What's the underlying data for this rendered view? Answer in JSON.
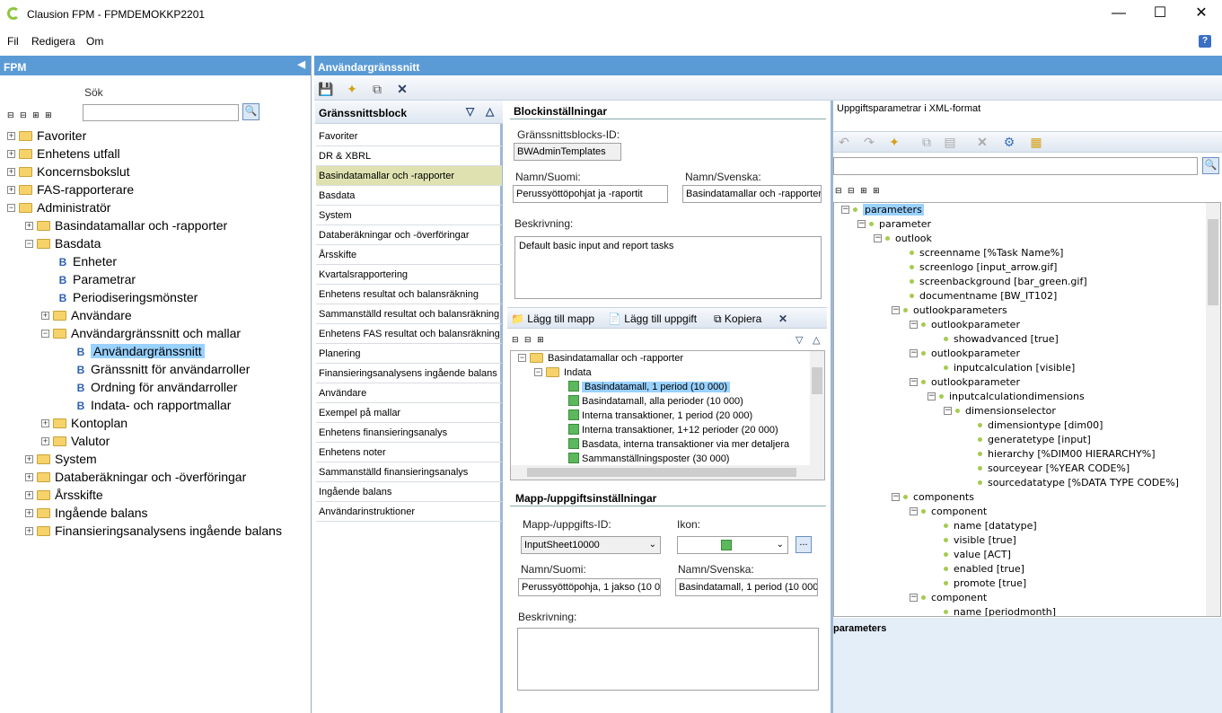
{
  "window": {
    "title": "Clausion FPM - FPMDEMOKKP2201"
  },
  "menu": [
    "Fil",
    "Redigera",
    "Om"
  ],
  "left": {
    "header": "FPM",
    "search_label": "Sök",
    "tree": [
      "Favoriter",
      "Enhetens utfall",
      "Koncernsbokslut",
      "FAS-rapporterare",
      "Administratör",
      "Basindatamallar och -rapporter",
      "Basdata",
      "Enheter",
      "Parametrar",
      "Periodiseringsmönster",
      "Användare",
      "Användargränssnitt och mallar",
      "Användargränssnitt",
      "Gränssnitt för användarroller",
      "Ordning för användarroller",
      "Indata- och rapportmallar",
      "Kontoplan",
      "Valutor",
      "System",
      "Databeräkningar och -överföringar",
      "Årsskifte",
      "Ingående balans",
      "Finansieringsanalysens ingående balans"
    ]
  },
  "main": {
    "header": "Användargränssnitt"
  },
  "blocks": {
    "header": "Gränssnittsblock",
    "items": [
      "Favoriter",
      "DR & XBRL",
      "Basindatamallar och -rapporter",
      "Basdata",
      "System",
      "Databeräkningar och -överföringar",
      "Årsskifte",
      "Kvartalsrapportering",
      "Enhetens resultat och balansräkning",
      "Sammanställd resultat och balansräkning",
      "Enhetens FAS resultat och balansräkning",
      "Planering",
      "Finansieringsanalysens ingående balans",
      "Användare",
      "Exempel på mallar",
      "Enhetens finansieringsanalys",
      "Enhetens noter",
      "Sammanställd finansieringsanalys",
      "Ingående balans",
      "Användarinstruktioner"
    ]
  },
  "block_settings": {
    "header": "Blockinställningar",
    "id_label": "Gränssnittsblocks-ID:",
    "id_value": "BWAdminTemplates",
    "name_fi_label": "Namn/Suomi:",
    "name_fi_value": "Perussyöttöpohjat ja -raportit",
    "name_sv_label": "Namn/Svenska:",
    "name_sv_value": "Basindatamallar och -rapporter",
    "desc_label": "Beskrivning:",
    "desc_value": "Default basic input and report tasks"
  },
  "map_toolbar": {
    "add_folder": "Lägg till mapp",
    "add_task": "Lägg till uppgift",
    "copy": "Kopiera"
  },
  "task_tree": [
    "Basindatamallar och -rapporter",
    "Indata",
    "Basindatamall, 1 period (10 000)",
    "Basindatamall, alla perioder (10 000)",
    "Interna transaktioner, 1 period (20 000)",
    "Interna transaktioner, 1+12 perioder (20 000)",
    "Basdata, interna transaktioner via mer detaljera",
    "Sammanställningsposter (30 000)"
  ],
  "task_settings": {
    "header": "Mapp-/uppgiftsinställningar",
    "id_label": "Mapp-/uppgifts-ID:",
    "id_value": "InputSheet10000",
    "icon_label": "Ikon:",
    "name_fi_label": "Namn/Suomi:",
    "name_fi_value": "Perussyöttöpohja, 1 jakso (10 0",
    "name_sv_label": "Namn/Svenska:",
    "name_sv_value": "Basindatamall, 1 period (10 000)",
    "desc_label": "Beskrivning:",
    "desc_value": ""
  },
  "xml": {
    "header": "Uppgiftsparametrar i XML-format",
    "nodes": [
      "parameters",
      "parameter",
      "outlook",
      "screenname [%Task Name%]",
      "screenlogo [input_arrow.gif]",
      "screenbackground [bar_green.gif]",
      "documentname [BW_IT102]",
      "outlookparameters",
      "outlookparameter",
      "showadvanced [true]",
      "outlookparameter",
      "inputcalculation [visible]",
      "outlookparameter",
      "inputcalculationdimensions",
      "dimensionselector",
      "dimensiontype [dim00]",
      "generatetype [input]",
      "hierarchy [%DIM00 HIERARCHY%]",
      "sourceyear [%YEAR CODE%]",
      "sourcedatatype [%DATA TYPE CODE%]",
      "components",
      "component",
      "name [datatype]",
      "visible [true]",
      "value [ACT]",
      "enabled [true]",
      "promote [true]",
      "component",
      "name [periodmonth]"
    ],
    "selected_label": "parameters"
  }
}
